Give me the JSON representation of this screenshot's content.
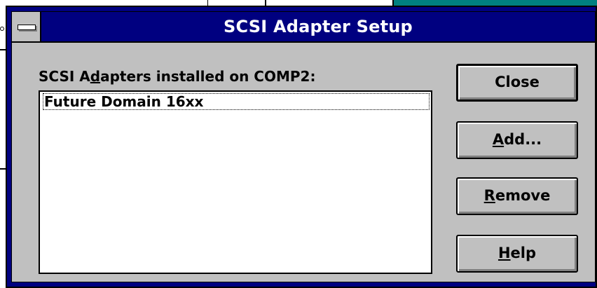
{
  "window": {
    "title": "SCSI Adapter Setup"
  },
  "list": {
    "label_before": "SCSI A",
    "label_mnemonic": "d",
    "label_after": "apters installed on COMP2:",
    "items": [
      {
        "label": "Future Domain 16xx"
      }
    ]
  },
  "buttons": {
    "close": {
      "label": "Close"
    },
    "add": {
      "mnemonic": "A",
      "rest": "dd..."
    },
    "remove": {
      "mnemonic": "R",
      "rest": "emove"
    },
    "help": {
      "mnemonic": "H",
      "rest": "elp"
    }
  },
  "colors": {
    "titlebar": "#000080",
    "face": "#c0c0c0",
    "background_window": "#008080"
  }
}
